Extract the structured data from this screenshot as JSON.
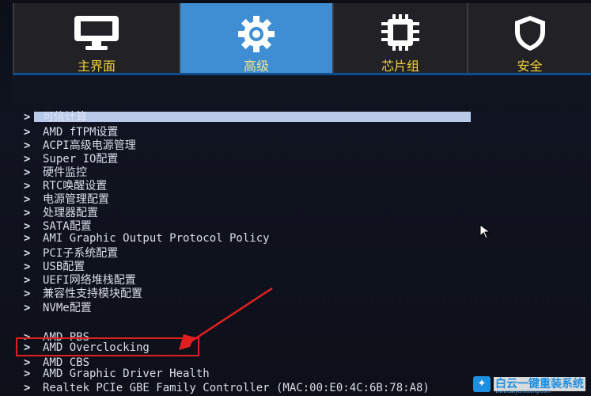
{
  "tabs": [
    {
      "label": "主界面",
      "icon": "monitor-icon"
    },
    {
      "label": "高级",
      "icon": "gear-icon"
    },
    {
      "label": "芯片组",
      "icon": "chip-icon"
    },
    {
      "label": "安全",
      "icon": "shield-icon"
    }
  ],
  "active_tab": "高级",
  "menu": {
    "items": [
      {
        "label": "可信计算"
      },
      {
        "label": "AMD fTPM设置"
      },
      {
        "label": "ACPI高级电源管理"
      },
      {
        "label": "Super IO配置"
      },
      {
        "label": "硬件监控"
      },
      {
        "label": "RTC唤醒设置"
      },
      {
        "label": "电源管理配置"
      },
      {
        "label": "处理器配置"
      },
      {
        "label": "SATA配置"
      },
      {
        "label": "AMI Graphic Output Protocol Policy"
      },
      {
        "label": "PCI子系统配置"
      },
      {
        "label": "USB配置"
      },
      {
        "label": "UEFI网络堆栈配置"
      },
      {
        "label": "兼容性支持模块配置"
      },
      {
        "label": "NVMe配置"
      },
      {
        "label": "AMD PBS"
      },
      {
        "label": "AMD Overclocking"
      },
      {
        "label": "AMD CBS"
      },
      {
        "label": "AMD Graphic Driver Health"
      },
      {
        "label": "Realtek PCIe GBE Family Controller (MAC:00:E0:4C:6B:78:A8)"
      }
    ],
    "arrow": ">",
    "selected_index": 0,
    "annotated_index": 16
  },
  "watermark": {
    "text": "白云一键重装系统",
    "sub": "www.baiyunxitong.com",
    "logo": "bird-icon"
  },
  "colors": {
    "active_tab": "#3f8ed3",
    "tab_label": "#f0d23c",
    "annotation": "#e02020",
    "highlight": "#b9c9e8"
  }
}
